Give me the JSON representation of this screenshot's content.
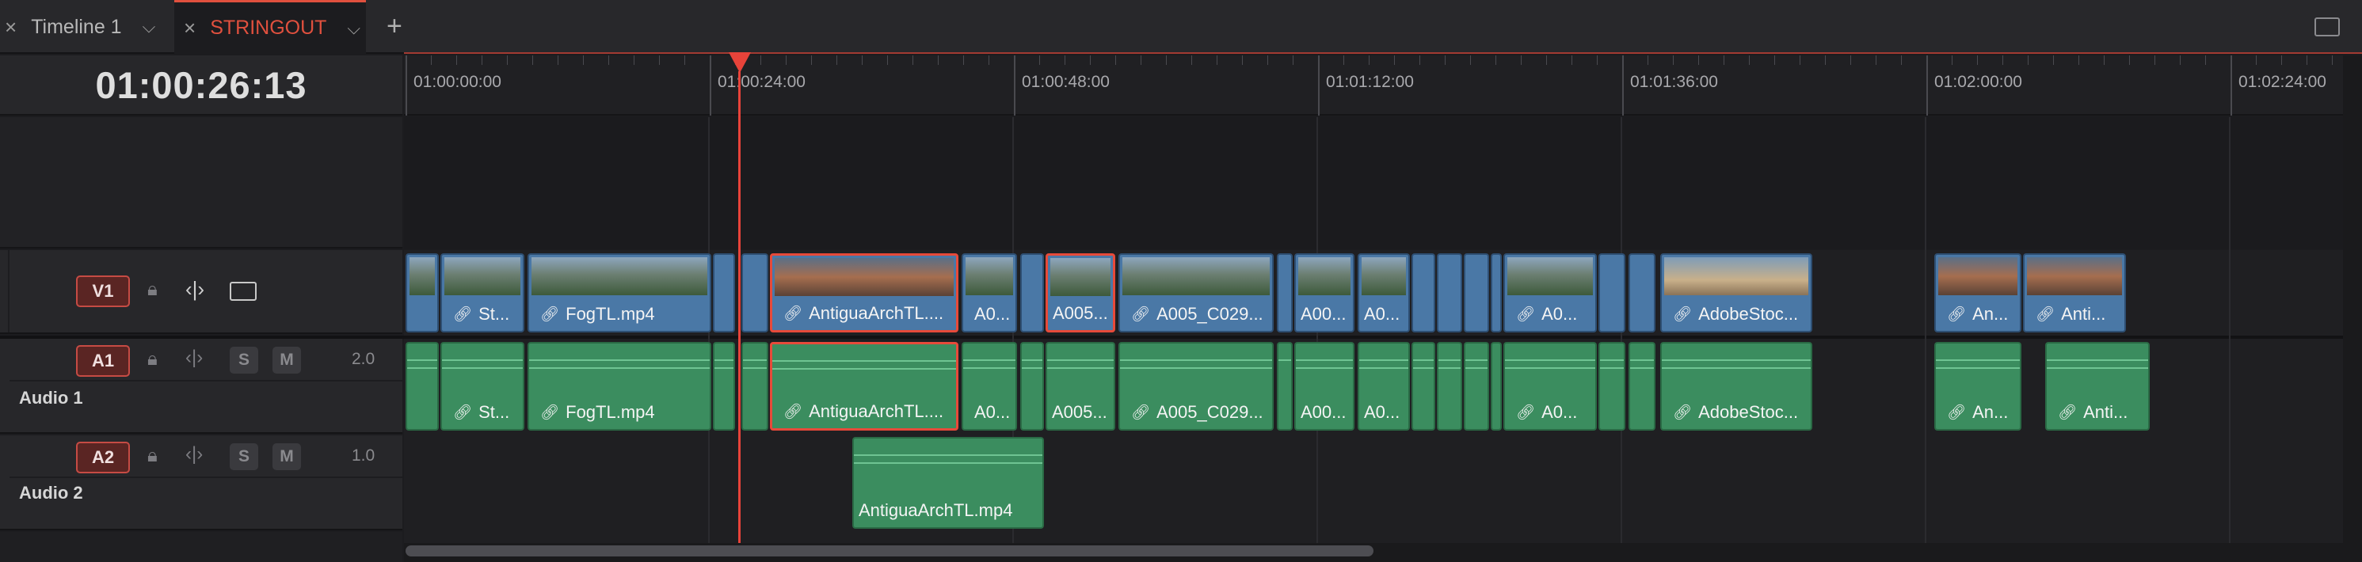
{
  "tabs": [
    {
      "label": "Timeline 1",
      "close": "×",
      "chevron": "⌵"
    },
    {
      "label": "STRINGOUT",
      "close": "×",
      "chevron": "⌵",
      "active": true
    }
  ],
  "add_tab": "+",
  "timecode": "01:00:26:13",
  "ruler_labels": [
    "01:00:00:00",
    "01:00:24:00",
    "01:00:48:00",
    "01:01:12:00",
    "01:01:36:00",
    "01:02:00:00",
    "01:02:24:00"
  ],
  "tracks": {
    "v1": {
      "badge": "V1"
    },
    "a1": {
      "badge": "A1",
      "name": "Audio 1",
      "volume": "2.0",
      "solo": "S",
      "mute": "M"
    },
    "a2": {
      "badge": "A2",
      "name": "Audio 2",
      "volume": "1.0",
      "solo": "S",
      "mute": "M"
    }
  },
  "video_clips": [
    "St...",
    "FogTL.mp4",
    "AntiguaArchTL....",
    "A0...",
    "A005...",
    "A005_C029...",
    "A00...",
    "A0...",
    "A0...",
    "AdobeStoc...",
    "An...",
    "Anti..."
  ],
  "audio1_clips": [
    "St...",
    "FogTL.mp4",
    "AntiguaArchTL....",
    "A0...",
    "A005...",
    "A005_C029...",
    "A00...",
    "A0...",
    "A0...",
    "AdobeStoc...",
    "An...",
    "Anti..."
  ],
  "audio2_clips": [
    "AntiguaArchTL.mp4"
  ],
  "colors": {
    "accent": "#e8433a",
    "video_clip": "#4a78a6",
    "audio_clip": "#3b8d5f"
  }
}
